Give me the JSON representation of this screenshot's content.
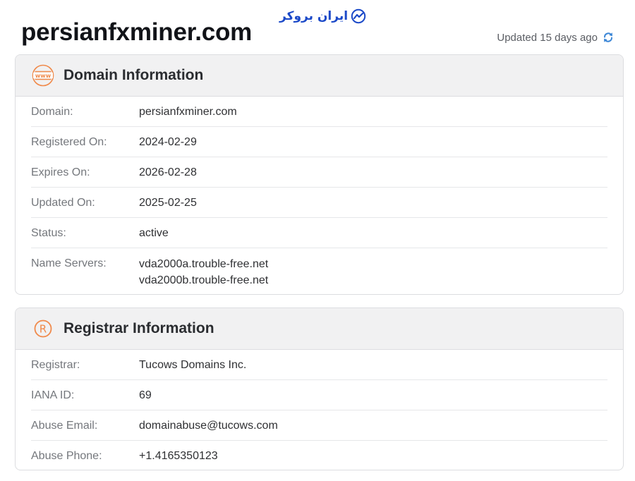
{
  "brand": {
    "name": "ایران بروکر"
  },
  "site": {
    "title": "persianfxminer.com"
  },
  "status_bar": {
    "updated_text": "Updated 15 days ago"
  },
  "domain_card": {
    "title": "Domain Information",
    "rows": [
      {
        "label": "Domain:",
        "value": "persianfxminer.com"
      },
      {
        "label": "Registered On:",
        "value": "2024-02-29"
      },
      {
        "label": "Expires On:",
        "value": "2026-02-28"
      },
      {
        "label": "Updated On:",
        "value": "2025-02-25"
      },
      {
        "label": "Status:",
        "value": "active"
      },
      {
        "label": "Name Servers:",
        "values": [
          "vda2000a.trouble-free.net",
          "vda2000b.trouble-free.net"
        ]
      }
    ]
  },
  "registrar_card": {
    "title": "Registrar Information",
    "rows": [
      {
        "label": "Registrar:",
        "value": "Tucows Domains Inc."
      },
      {
        "label": "IANA ID:",
        "value": "69"
      },
      {
        "label": "Abuse Email:",
        "value": "domainabuse@tucows.com"
      },
      {
        "label": "Abuse Phone:",
        "value": "+1.4165350123"
      }
    ]
  },
  "colors": {
    "accent_orange": "#f08a4b",
    "brand_blue": "#1b49c8",
    "refresh_blue": "#3b86d6"
  },
  "icons": {
    "domain": "www-icon",
    "registrar": "registered-icon",
    "refresh": "refresh-icon",
    "brand": "chart-logo-icon"
  }
}
